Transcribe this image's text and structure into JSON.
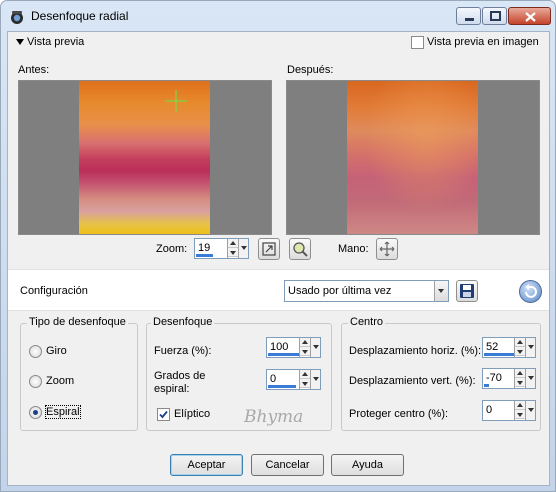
{
  "window": {
    "title": "Desenfoque radial",
    "buttons": [
      "minimize",
      "maximize",
      "close"
    ]
  },
  "preview": {
    "toggle_label": "Vista previa",
    "image_preview_label": "Vista previa en imagen",
    "image_preview_checked": false,
    "before_label": "Antes:",
    "after_label": "Después:",
    "zoom_label": "Zoom:",
    "zoom_value": "19",
    "pan_label": "Mano:"
  },
  "config": {
    "label": "Configuración",
    "preset_value": "Usado por última vez"
  },
  "blur_type": {
    "title": "Tipo de desenfoque",
    "options": [
      "Giro",
      "Zoom",
      "Espiral"
    ],
    "selected": "Espiral"
  },
  "blur": {
    "title": "Desenfoque",
    "strength_label": "Fuerza (%):",
    "strength_value": "100",
    "spiral_degrees_label_1": "Grados de",
    "spiral_degrees_label_2": "espiral:",
    "spiral_degrees_value": "0",
    "elliptic_label": "Elíptico",
    "elliptic_checked": true
  },
  "center": {
    "title": "Centro",
    "horiz_label": "Desplazamiento horiz. (%):",
    "horiz_value": "52",
    "vert_label": "Desplazamiento vert. (%):",
    "vert_value": "-70",
    "protect_label": "Proteger centro (%):",
    "protect_value": "0"
  },
  "watermark": "Bhyma",
  "footer": {
    "ok_label": "Aceptar",
    "cancel_label": "Cancelar",
    "help_label": "Ayuda"
  },
  "colors": {
    "accent": "#3a7bd5",
    "title_bar_top": "#d9e6f5",
    "close_red": "#c5432a",
    "dialog_bg": "#f0f0f0"
  }
}
